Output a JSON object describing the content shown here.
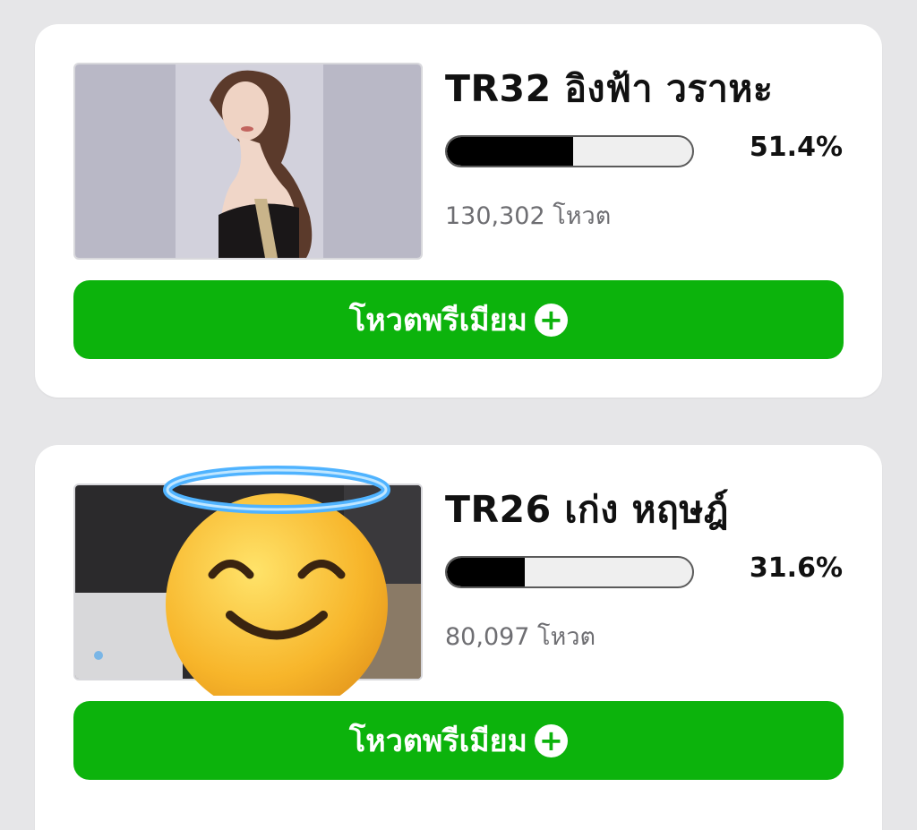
{
  "candidates": [
    {
      "name": "TR32 อิงฟ้า วราหะ",
      "percent_label": "51.4%",
      "percent": 51.4,
      "votes_label": "130,302 โหวต",
      "vote_button_label": "โหวตพรีเมียม",
      "photo_icon": "portrait-photo"
    },
    {
      "name": "TR26 เก่ง หฤษฎ์",
      "percent_label": "31.6%",
      "percent": 31.6,
      "votes_label": "80,097 โหวต",
      "vote_button_label": "โหวตพรีเมียม",
      "photo_icon": "smiling-face-with-halo-emoji"
    }
  ],
  "colors": {
    "button_green": "#0cb30c",
    "bar_fill": "#000000",
    "bar_track": "#efefef",
    "page_background": "#e6e6e8"
  }
}
